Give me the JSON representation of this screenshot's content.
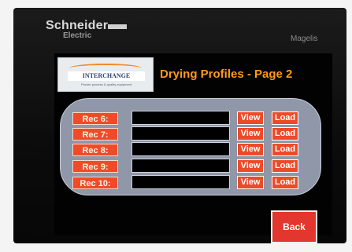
{
  "device": {
    "brand": "Schneider",
    "brand_sub": "Electric",
    "model": "Magelis"
  },
  "header": {
    "logo_name": "INTERCHANGE",
    "logo_tagline": "Proven process & quality equipment",
    "title": "Drying Profiles - Page 2"
  },
  "records": [
    {
      "label": "Rec 6:",
      "value": "",
      "view": "View",
      "load": "Load"
    },
    {
      "label": "Rec 7:",
      "value": "",
      "view": "View",
      "load": "Load"
    },
    {
      "label": "Rec 8:",
      "value": "",
      "view": "View",
      "load": "Load"
    },
    {
      "label": "Rec 9:",
      "value": "",
      "view": "View",
      "load": "Load"
    },
    {
      "label": "Rec 10:",
      "value": "",
      "view": "View",
      "load": "Load"
    }
  ],
  "footer": {
    "back_label": "Back"
  },
  "colors": {
    "title": "#ff9a1c",
    "button": "#ee4a28",
    "panel": "#8f97a8",
    "screen": "#020202"
  }
}
